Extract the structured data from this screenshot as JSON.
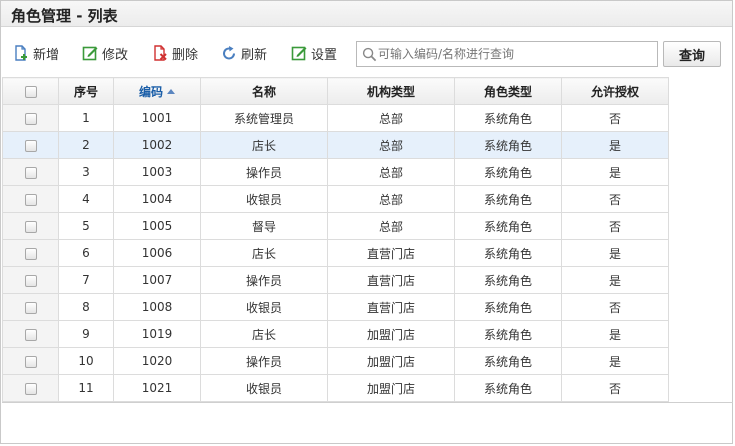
{
  "title": "角色管理 - 列表",
  "toolbar": {
    "add": "新增",
    "edit": "修改",
    "delete": "删除",
    "refresh": "刷新",
    "settings": "设置",
    "search_placeholder": "可输入编码/名称进行查询",
    "query": "查询"
  },
  "colors": {
    "add_icon": "#4a7fc0",
    "edit_icon": "#3a9a3a",
    "delete_icon": "#d03030",
    "refresh_icon": "#4a7fc0",
    "settings_icon": "#3a9a3a",
    "code_link": "#1a5ea8",
    "selected_row": "#e6f0fb"
  },
  "table": {
    "columns": [
      "序号",
      "编码",
      "名称",
      "机构类型",
      "角色类型",
      "允许授权"
    ],
    "sort_column": "编码",
    "sort_direction": "asc",
    "selected_row": 2,
    "rows": [
      {
        "no": "1",
        "code": "1001",
        "name": "系统管理员",
        "org_type": "总部",
        "role_type": "系统角色",
        "allow": "否"
      },
      {
        "no": "2",
        "code": "1002",
        "name": "店长",
        "org_type": "总部",
        "role_type": "系统角色",
        "allow": "是"
      },
      {
        "no": "3",
        "code": "1003",
        "name": "操作员",
        "org_type": "总部",
        "role_type": "系统角色",
        "allow": "是"
      },
      {
        "no": "4",
        "code": "1004",
        "name": "收银员",
        "org_type": "总部",
        "role_type": "系统角色",
        "allow": "否"
      },
      {
        "no": "5",
        "code": "1005",
        "name": "督导",
        "org_type": "总部",
        "role_type": "系统角色",
        "allow": "否"
      },
      {
        "no": "6",
        "code": "1006",
        "name": "店长",
        "org_type": "直营门店",
        "role_type": "系统角色",
        "allow": "是"
      },
      {
        "no": "7",
        "code": "1007",
        "name": "操作员",
        "org_type": "直营门店",
        "role_type": "系统角色",
        "allow": "是"
      },
      {
        "no": "8",
        "code": "1008",
        "name": "收银员",
        "org_type": "直营门店",
        "role_type": "系统角色",
        "allow": "否"
      },
      {
        "no": "9",
        "code": "1019",
        "name": "店长",
        "org_type": "加盟门店",
        "role_type": "系统角色",
        "allow": "是"
      },
      {
        "no": "10",
        "code": "1020",
        "name": "操作员",
        "org_type": "加盟门店",
        "role_type": "系统角色",
        "allow": "是"
      },
      {
        "no": "11",
        "code": "1021",
        "name": "收银员",
        "org_type": "加盟门店",
        "role_type": "系统角色",
        "allow": "否"
      }
    ]
  }
}
